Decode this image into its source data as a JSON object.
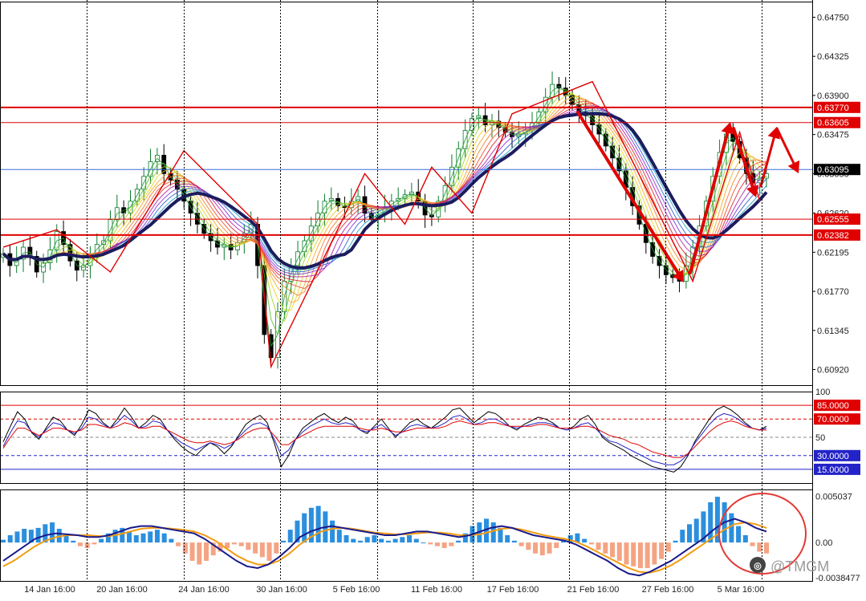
{
  "chart_data": [
    {
      "type": "candlestick",
      "panel": "price",
      "price_ticks": [
        "0.64750",
        "0.64325",
        "0.63900",
        "0.63475",
        "0.63050",
        "0.62620",
        "0.62195",
        "0.61770",
        "0.61345",
        "0.60920"
      ],
      "ylim": [
        0.6075,
        0.6492
      ],
      "x_labels": [
        "14 Jan 16:00",
        "20 Jan 16:00",
        "24 Jan 16:00",
        "30 Jan 16:00",
        "5 Feb 16:00",
        "11 Feb 16:00",
        "17 Feb 16:00",
        "21 Feb 16:00",
        "27 Feb 16:00",
        "5 Mar 16:00"
      ],
      "horizontal_levels": [
        {
          "value": 0.6377,
          "label": "0.63770",
          "color": "#e00000",
          "style": "thick"
        },
        {
          "value": 0.63605,
          "label": "0.63605",
          "color": "#e00000",
          "style": "thin"
        },
        {
          "value": 0.63095,
          "label": "0.63095",
          "color": "#3a6fd8",
          "style": "thin",
          "tag_color": "#000000"
        },
        {
          "value": 0.62555,
          "label": "0.62555",
          "color": "#e00000",
          "style": "thin"
        },
        {
          "value": 0.62382,
          "label": "0.62382",
          "color": "#e00000",
          "style": "thick"
        }
      ],
      "close_series": [
        0.6218,
        0.6205,
        0.6212,
        0.6225,
        0.6215,
        0.6198,
        0.6208,
        0.6222,
        0.6242,
        0.6228,
        0.621,
        0.62,
        0.6205,
        0.6218,
        0.6228,
        0.6232,
        0.6255,
        0.6268,
        0.6262,
        0.6275,
        0.6288,
        0.6302,
        0.6318,
        0.6325,
        0.6305,
        0.6298,
        0.6288,
        0.6275,
        0.6262,
        0.625,
        0.624,
        0.6232,
        0.6225,
        0.6228,
        0.6222,
        0.623,
        0.624,
        0.625,
        0.6205,
        0.613,
        0.6105,
        0.6155,
        0.6188,
        0.6205,
        0.622,
        0.6232,
        0.6248,
        0.6262,
        0.6275,
        0.6278,
        0.627,
        0.6268,
        0.6275,
        0.628,
        0.6262,
        0.6255,
        0.626,
        0.6268,
        0.6275,
        0.6278,
        0.6282,
        0.6285,
        0.6275,
        0.626,
        0.6258,
        0.6275,
        0.6292,
        0.6312,
        0.6332,
        0.6352,
        0.6365,
        0.6368,
        0.6358,
        0.6362,
        0.6355,
        0.635,
        0.6345,
        0.6348,
        0.6352,
        0.636,
        0.6372,
        0.6388,
        0.6402,
        0.6398,
        0.639,
        0.638,
        0.6372,
        0.6368,
        0.6358,
        0.6348,
        0.6335,
        0.6322,
        0.6308,
        0.629,
        0.627,
        0.625,
        0.623,
        0.6215,
        0.6205,
        0.6195,
        0.6192,
        0.6188,
        0.6205,
        0.6225,
        0.6248,
        0.6275,
        0.6302,
        0.6328,
        0.6348,
        0.634,
        0.6322,
        0.6305,
        0.6295,
        0.63,
        0.6305
      ],
      "annotations": [
        "red zigzag trend lines",
        "red arrows projecting price path",
        "thick navy moving average",
        "rainbow moving average ribbon"
      ]
    },
    {
      "type": "line",
      "panel": "oscillator",
      "ylim": [
        0,
        100
      ],
      "ticks": [
        "100",
        "50"
      ],
      "levels": [
        {
          "value": 85,
          "label": "85.0000",
          "color": "#e00000",
          "tag_color": "#e00000"
        },
        {
          "value": 70,
          "label": "70.0000",
          "color": "#e00000",
          "dashed": true,
          "tag_color": "#e00000"
        },
        {
          "value": 50,
          "label": "",
          "color": "#888888",
          "dashed": true
        },
        {
          "value": 30,
          "label": "30.0000",
          "color": "#2323c8",
          "dashed": true,
          "tag_color": "#2323c8"
        },
        {
          "value": 15,
          "label": "15.0000",
          "color": "#2323c8",
          "tag_color": "#2323c8"
        }
      ],
      "series": [
        {
          "color": "#000000",
          "values": [
            45,
            62,
            78,
            70,
            55,
            48,
            60,
            72,
            68,
            58,
            52,
            64,
            80,
            76,
            66,
            60,
            70,
            82,
            72,
            60,
            66,
            74,
            70,
            58,
            48,
            40,
            34,
            30,
            38,
            44,
            40,
            32,
            40,
            52,
            64,
            70,
            74,
            66,
            44,
            18,
            30,
            48,
            60,
            66,
            72,
            76,
            70,
            66,
            72,
            68,
            58,
            54,
            62,
            70,
            60,
            50,
            58,
            66,
            70,
            64,
            60,
            66,
            72,
            80,
            82,
            74,
            66,
            72,
            78,
            76,
            70,
            62,
            58,
            64,
            68,
            72,
            70,
            66,
            60,
            58,
            62,
            70,
            74,
            64,
            50,
            44,
            40,
            36,
            30,
            26,
            22,
            18,
            16,
            14,
            12,
            18,
            30,
            46,
            58,
            70,
            80,
            84,
            80,
            74,
            66,
            60,
            58,
            62
          ]
        },
        {
          "color": "#2323c8",
          "values": [
            40,
            55,
            68,
            66,
            56,
            50,
            58,
            66,
            64,
            58,
            54,
            60,
            72,
            70,
            64,
            60,
            66,
            74,
            68,
            60,
            62,
            68,
            66,
            58,
            50,
            44,
            40,
            36,
            40,
            44,
            42,
            38,
            42,
            50,
            58,
            64,
            66,
            62,
            48,
            30,
            36,
            48,
            56,
            62,
            66,
            70,
            66,
            64,
            66,
            64,
            58,
            56,
            60,
            64,
            58,
            52,
            56,
            62,
            64,
            62,
            60,
            62,
            66,
            72,
            74,
            70,
            64,
            66,
            70,
            70,
            66,
            62,
            60,
            62,
            64,
            66,
            66,
            64,
            60,
            58,
            60,
            64,
            66,
            60,
            52,
            46,
            44,
            40,
            36,
            32,
            28,
            24,
            22,
            20,
            20,
            24,
            32,
            44,
            54,
            64,
            72,
            76,
            74,
            70,
            64,
            60,
            58,
            60
          ]
        },
        {
          "color": "#e00000",
          "values": [
            38,
            50,
            60,
            60,
            56,
            52,
            56,
            60,
            60,
            58,
            56,
            58,
            64,
            64,
            62,
            60,
            62,
            66,
            64,
            60,
            60,
            62,
            62,
            58,
            54,
            50,
            46,
            44,
            44,
            46,
            44,
            42,
            44,
            48,
            54,
            58,
            60,
            60,
            52,
            42,
            42,
            48,
            52,
            56,
            60,
            62,
            62,
            62,
            62,
            62,
            60,
            58,
            58,
            60,
            58,
            56,
            56,
            58,
            60,
            60,
            60,
            60,
            62,
            66,
            68,
            66,
            64,
            64,
            66,
            66,
            64,
            62,
            62,
            62,
            62,
            64,
            64,
            62,
            60,
            60,
            60,
            62,
            62,
            60,
            56,
            52,
            50,
            48,
            44,
            42,
            38,
            34,
            32,
            30,
            28,
            28,
            32,
            40,
            48,
            56,
            62,
            66,
            68,
            66,
            62,
            60,
            58,
            58
          ]
        }
      ]
    },
    {
      "type": "histogram+line",
      "panel": "macd",
      "ticks": [
        "0.005037",
        "0.00",
        "-0.0038477"
      ],
      "ylim": [
        -0.0042,
        0.0058
      ],
      "colors": {
        "positive": "#2b8fde",
        "negative": "#f4a483",
        "signal": "#f39c12",
        "main": "#1a1a8c",
        "circle": "#e53935"
      },
      "histogram": [
        0.0003,
        0.0008,
        0.0012,
        0.0015,
        0.0014,
        0.0016,
        0.002,
        0.0022,
        0.0015,
        0.0008,
        0.0002,
        -0.0004,
        -0.0006,
        -0.0002,
        0.0004,
        0.001,
        0.0014,
        0.0016,
        0.0012,
        0.0008,
        0.001,
        0.0012,
        0.0014,
        0.001,
        0.0004,
        -0.0004,
        -0.0012,
        -0.002,
        -0.0024,
        -0.002,
        -0.0014,
        -0.001,
        -0.0006,
        -0.0002,
        -0.0004,
        -0.0008,
        -0.0012,
        -0.0016,
        -0.002,
        -0.0012,
        0.0002,
        0.0014,
        0.0024,
        0.0032,
        0.0038,
        0.004,
        0.0034,
        0.0024,
        0.0014,
        0.0008,
        0.0004,
        0.0002,
        0.0006,
        0.0008,
        0.0004,
        0.0002,
        0.0004,
        0.0006,
        0.0008,
        0.0004,
        0.0,
        -0.0002,
        -0.0004,
        -0.0006,
        -0.0004,
        0.0002,
        0.001,
        0.0018,
        0.0022,
        0.0026,
        0.0022,
        0.0016,
        0.0008,
        0.0002,
        -0.0004,
        -0.0008,
        -0.0012,
        -0.0014,
        -0.0012,
        -0.0006,
        0.0002,
        0.0008,
        0.001,
        0.0004,
        -0.0002,
        -0.0008,
        -0.0012,
        -0.0016,
        -0.002,
        -0.0024,
        -0.0026,
        -0.0028,
        -0.0028,
        -0.0024,
        -0.0018,
        -0.001,
        0.0002,
        0.0014,
        0.002,
        0.0026,
        0.0034,
        0.0044,
        0.005,
        0.0044,
        0.0032,
        0.0018,
        0.0008,
        -0.0004,
        -0.001,
        -0.0012
      ],
      "main_line": [
        -0.002,
        -0.0012,
        -0.0004,
        0.0004,
        0.0008,
        0.001,
        0.0009,
        0.0008,
        0.0006,
        0.0006,
        0.0008,
        0.0012,
        0.0016,
        0.0018,
        0.0018,
        0.0016,
        0.0014,
        0.0012,
        0.001,
        0.0004,
        -0.0004,
        -0.0012,
        -0.002,
        -0.0026,
        -0.0028,
        -0.0024,
        -0.0016,
        -0.0006,
        0.0006,
        0.0012,
        0.0016,
        0.0018,
        0.0016,
        0.0014,
        0.0012,
        0.001,
        0.0008,
        0.0008,
        0.001,
        0.0012,
        0.0012,
        0.001,
        0.0008,
        0.0006,
        0.0008,
        0.0012,
        0.0016,
        0.0018,
        0.0016,
        0.0012,
        0.0008,
        0.0006,
        0.0004,
        0.0002,
        -0.0002,
        -0.0008,
        -0.0014,
        -0.002,
        -0.0028,
        -0.0034,
        -0.0036,
        -0.0032,
        -0.0026,
        -0.002,
        -0.0012,
        -0.0004,
        0.0004,
        0.0014,
        0.0022,
        0.0026,
        0.0022,
        0.0016,
        0.0012
      ],
      "signal_line": [
        -0.0026,
        -0.002,
        -0.0012,
        -0.0004,
        0.0002,
        0.0006,
        0.0008,
        0.0008,
        0.0008,
        0.0007,
        0.0007,
        0.0009,
        0.0012,
        0.0015,
        0.0016,
        0.0016,
        0.0015,
        0.0014,
        0.0012,
        0.0008,
        0.0002,
        -0.0006,
        -0.0014,
        -0.002,
        -0.0024,
        -0.0024,
        -0.002,
        -0.0012,
        -0.0002,
        0.0006,
        0.0012,
        0.0015,
        0.0016,
        0.0015,
        0.0013,
        0.0011,
        0.001,
        0.0009,
        0.0009,
        0.001,
        0.0011,
        0.0011,
        0.001,
        0.0008,
        0.0008,
        0.0009,
        0.0012,
        0.0015,
        0.0016,
        0.0014,
        0.0011,
        0.0008,
        0.0006,
        0.0004,
        0.0001,
        -0.0004,
        -0.001,
        -0.0016,
        -0.0022,
        -0.0028,
        -0.0032,
        -0.0033,
        -0.003,
        -0.0025,
        -0.0018,
        -0.001,
        -0.0002,
        0.0006,
        0.0014,
        0.002,
        0.0022,
        0.002,
        0.0016
      ]
    }
  ],
  "watermark": {
    "brand": "@TMGM",
    "logo": "TMGM"
  }
}
